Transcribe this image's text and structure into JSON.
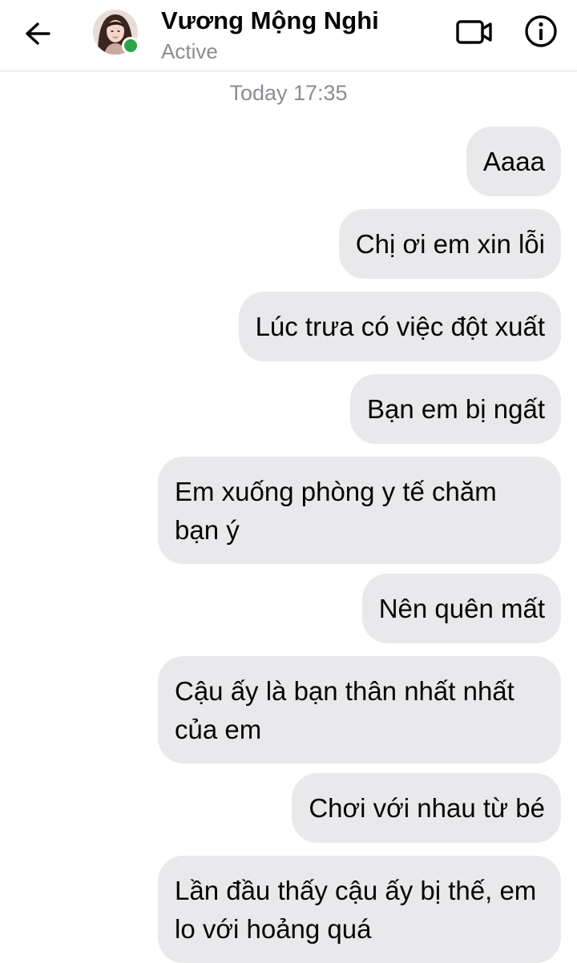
{
  "header": {
    "contact_name": "Vương Mộng Nghi",
    "status": "Active",
    "presence_color": "#31a24c",
    "icons": {
      "back": "arrow-left-icon",
      "video": "video-call-icon",
      "info": "info-icon"
    }
  },
  "conversation": {
    "timestamp": "Today 17:35",
    "messages": [
      {
        "text": "Aaaa",
        "sender": "me"
      },
      {
        "text": "Chị ơi em xin lỗi",
        "sender": "me"
      },
      {
        "text": "Lúc trưa có việc đột xuất",
        "sender": "me"
      },
      {
        "text": "Bạn em bị ngất",
        "sender": "me"
      },
      {
        "text": "Em xuống phòng y tế chăm bạn ý",
        "sender": "me"
      },
      {
        "text": "Nên quên mất",
        "sender": "me"
      },
      {
        "text": "Cậu ấy là bạn thân nhất nhất của em",
        "sender": "me"
      },
      {
        "text": "Chơi với nhau từ bé",
        "sender": "me"
      },
      {
        "text": "Lần đầu thấy cậu ấy bị thế, em lo với hoảng quá",
        "sender": "me"
      }
    ]
  },
  "colors": {
    "bubble_background": "#e9e9eb",
    "secondary_text": "#8a8d91"
  }
}
